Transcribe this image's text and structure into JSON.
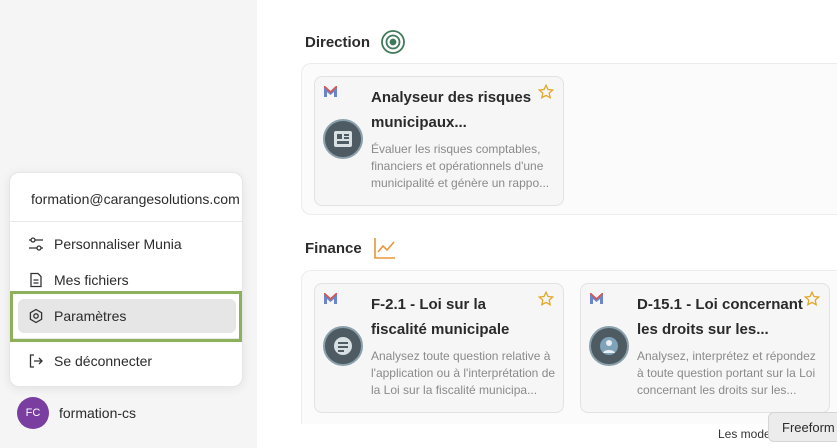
{
  "sections": [
    {
      "title": "Direction",
      "icon": "target-icon",
      "cards": [
        {
          "title": "Analyseur des risques municipaux...",
          "description": "Évaluer les risques comptables, financiers et opérationnels d'une municipalité et génère un rappo..."
        }
      ]
    },
    {
      "title": "Finance",
      "icon": "chart-line-icon",
      "cards": [
        {
          "title": "F-2.1 - Loi sur la fiscalité municipale",
          "description": "Analysez toute question relative à l'application ou à l'interprétation de la Loi sur la fiscalité municipa..."
        },
        {
          "title": "D-15.1 - Loi concernant les droits sur les...",
          "description": "Analysez, interprétez et répondez à toute question portant sur la Loi concernant les droits sur les..."
        }
      ]
    }
  ],
  "user_menu": {
    "email": "formation@carangesolutions.com",
    "items": [
      {
        "label": "Personnaliser Munia",
        "icon": "sliders-icon"
      },
      {
        "label": "Mes fichiers",
        "icon": "file-icon"
      },
      {
        "label": "Paramètres",
        "icon": "settings-icon",
        "active": true
      },
      {
        "label": "Se déconnecter",
        "icon": "logout-icon"
      }
    ]
  },
  "user": {
    "initials": "FC",
    "name": "formation-cs"
  },
  "footer": {
    "text": "Les mode",
    "freeform_label": "Freeform"
  },
  "colors": {
    "accent_green": "#8db05a",
    "avatar_purple": "#7a3ea0",
    "star": "#e0a929",
    "target_green": "#3f7a5a",
    "chart_orange": "#e8963a"
  }
}
